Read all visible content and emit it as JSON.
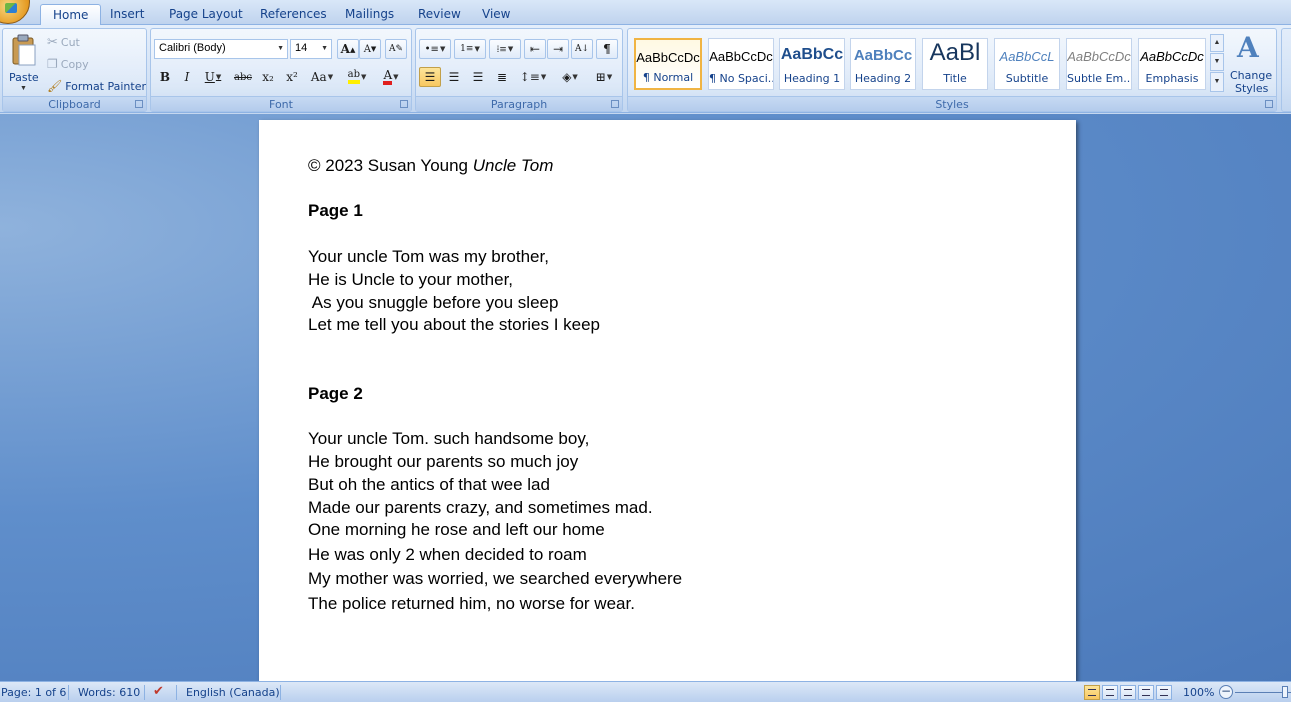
{
  "tabs": [
    {
      "label": "Home",
      "active": true
    },
    {
      "label": "Insert"
    },
    {
      "label": "Page Layout"
    },
    {
      "label": "References"
    },
    {
      "label": "Mailings"
    },
    {
      "label": "Review"
    },
    {
      "label": "View"
    }
  ],
  "clipboard": {
    "paste_label": "Paste",
    "cut_label": "Cut",
    "copy_label": "Copy",
    "format_painter_label": "Format Painter",
    "group_label": "Clipboard"
  },
  "font": {
    "family": "Calibri (Body)",
    "size": "14",
    "group_label": "Font",
    "bold_glyph": "B",
    "italic_glyph": "I",
    "underline_glyph": "U",
    "strike_glyph": "abc",
    "subscript_glyph": "x₂",
    "superscript_glyph": "x²",
    "case_glyph": "Aa",
    "grow_glyph": "A",
    "shrink_glyph": "A",
    "font_color_glyph": "A",
    "highlight_glyph": "ab"
  },
  "paragraph": {
    "group_label": "Paragraph",
    "pilcrow_glyph": "¶",
    "sort_glyph": "A↓"
  },
  "styles": {
    "group_label": "Styles",
    "change_styles_line1": "Change",
    "change_styles_line2": "Styles",
    "items": [
      {
        "sample": "AaBbCcDc",
        "name": "¶ Normal",
        "selected": true
      },
      {
        "sample": "AaBbCcDc",
        "name": "¶ No Spaci..."
      },
      {
        "sample": "AaBbCc",
        "name": "Heading 1"
      },
      {
        "sample": "AaBbCc",
        "name": "Heading 2"
      },
      {
        "sample": "AaBl",
        "name": "Title"
      },
      {
        "sample": "AaBbCcL",
        "name": "Subtitle"
      },
      {
        "sample": "AaBbCcDc",
        "name": "Subtle Em..."
      },
      {
        "sample": "AaBbCcDc",
        "name": "Emphasis"
      }
    ]
  },
  "document": {
    "copyright_plain": "© 2023 Susan Young ",
    "copyright_italic": "Uncle Tom",
    "page1_heading": "Page 1",
    "page1_lines": [
      "Your uncle Tom was my brother,",
      "He is Uncle to your mother,",
      " As you snuggle before you sleep",
      "Let me tell you about the stories I keep"
    ],
    "page2_heading": "Page 2",
    "page2_lines": [
      "Your uncle Tom. such handsome boy,",
      "He brought our parents so much joy",
      "But oh the antics of that wee lad",
      "Made our parents crazy, and sometimes mad.",
      "One morning he rose and left our home",
      "He was only 2 when decided to roam",
      "My mother was worried, we searched everywhere",
      "The police returned him, no worse for wear."
    ]
  },
  "status": {
    "page": "Page: 1 of 6",
    "words": "Words: 610",
    "language": "English (Canada)",
    "zoom": "100%"
  }
}
